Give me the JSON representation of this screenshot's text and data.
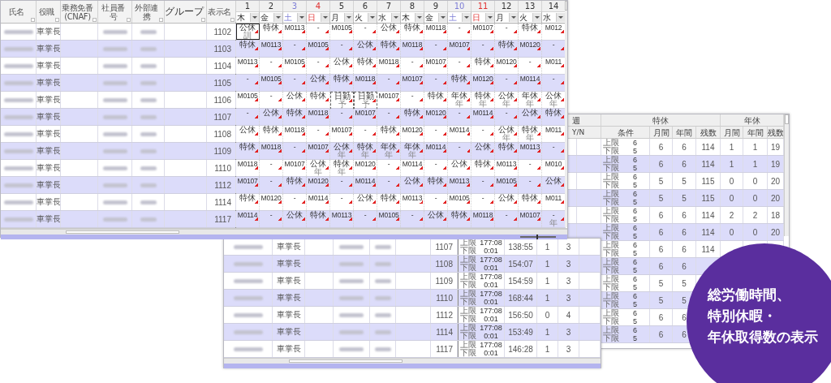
{
  "schedule_window": {
    "zoom": {
      "level": 0.45
    },
    "columns": [
      "氏名",
      "役職",
      "乗務免番 (CNAF)",
      "社員番号",
      "外部連携",
      "グループ",
      "表示名"
    ],
    "days": [
      {
        "number": "1",
        "weekday": "木",
        "kind": "weekday"
      },
      {
        "number": "2",
        "weekday": "金",
        "kind": "weekday"
      },
      {
        "number": "3",
        "weekday": "土",
        "kind": "saturday"
      },
      {
        "number": "4",
        "weekday": "日",
        "kind": "sunday"
      },
      {
        "number": "5",
        "weekday": "月",
        "kind": "weekday"
      },
      {
        "number": "6",
        "weekday": "火",
        "kind": "weekday"
      },
      {
        "number": "7",
        "weekday": "水",
        "kind": "weekday"
      },
      {
        "number": "8",
        "weekday": "木",
        "kind": "weekday"
      },
      {
        "number": "9",
        "weekday": "金",
        "kind": "weekday"
      },
      {
        "number": "10",
        "weekday": "土",
        "kind": "saturday"
      },
      {
        "number": "11",
        "weekday": "日",
        "kind": "sunday"
      },
      {
        "number": "12",
        "weekday": "月",
        "kind": "weekday"
      },
      {
        "number": "13",
        "weekday": "火",
        "kind": "weekday"
      },
      {
        "number": "14",
        "weekday": "水",
        "kind": "weekday"
      }
    ],
    "rows": [
      {
        "role": "車掌長",
        "display_name": "1102",
        "shifts": [
          {
            "text": "公休",
            "sub": "訓",
            "selected": true,
            "tentative": false
          },
          {
            "text": "特休",
            "selected": false,
            "tentative": false
          },
          {
            "text": "M0113",
            "selected": false,
            "tentative": false
          },
          {
            "text": "-",
            "selected": false,
            "tentative": false
          },
          {
            "text": "M0105",
            "selected": false,
            "tentative": false
          },
          {
            "text": "-",
            "selected": false,
            "tentative": false
          },
          {
            "text": "公休",
            "selected": false,
            "tentative": false
          },
          {
            "text": "特休",
            "selected": false,
            "tentative": false
          },
          {
            "text": "M0118",
            "selected": false,
            "tentative": false
          },
          {
            "text": "-",
            "selected": false,
            "tentative": false
          },
          {
            "text": "M0107",
            "selected": false,
            "tentative": false
          },
          {
            "text": "-",
            "selected": false,
            "tentative": false
          },
          {
            "text": "特休",
            "selected": false,
            "tentative": false
          },
          {
            "text": "M012",
            "selected": false,
            "tentative": false
          }
        ]
      },
      {
        "role": "車掌長",
        "display_name": "1103",
        "shifts": [
          {
            "text": "特休",
            "selected": false,
            "tentative": false
          },
          {
            "text": "M0113",
            "selected": false,
            "tentative": false
          },
          {
            "text": "-",
            "selected": false,
            "tentative": false
          },
          {
            "text": "M0105",
            "selected": false,
            "tentative": false
          },
          {
            "text": "-",
            "selected": false,
            "tentative": false
          },
          {
            "text": "公休",
            "selected": false,
            "tentative": false
          },
          {
            "text": "特休",
            "selected": false,
            "tentative": false
          },
          {
            "text": "M0118",
            "selected": false,
            "tentative": false
          },
          {
            "text": "-",
            "selected": false,
            "tentative": false
          },
          {
            "text": "M0107",
            "selected": false,
            "tentative": false
          },
          {
            "text": "-",
            "selected": false,
            "tentative": false
          },
          {
            "text": "特休",
            "selected": false,
            "tentative": false
          },
          {
            "text": "M0120",
            "selected": false,
            "tentative": false
          },
          {
            "text": "-",
            "selected": false,
            "tentative": false
          }
        ]
      },
      {
        "role": "車掌長",
        "display_name": "1104",
        "shifts": [
          {
            "text": "M0113",
            "selected": false,
            "tentative": false
          },
          {
            "text": "-",
            "selected": false,
            "tentative": false
          },
          {
            "text": "M0105",
            "selected": false,
            "tentative": false
          },
          {
            "text": "-",
            "selected": false,
            "tentative": false
          },
          {
            "text": "公休",
            "selected": false,
            "tentative": false
          },
          {
            "text": "特休",
            "selected": false,
            "tentative": false
          },
          {
            "text": "M0118",
            "selected": false,
            "tentative": false
          },
          {
            "text": "-",
            "selected": false,
            "tentative": false
          },
          {
            "text": "M0107",
            "selected": false,
            "tentative": false
          },
          {
            "text": "-",
            "selected": false,
            "tentative": false
          },
          {
            "text": "特休",
            "selected": false,
            "tentative": false
          },
          {
            "text": "M0120",
            "selected": false,
            "tentative": false
          },
          {
            "text": "-",
            "selected": false,
            "tentative": false
          },
          {
            "text": "M011",
            "selected": false,
            "tentative": false
          }
        ]
      },
      {
        "role": "車掌長",
        "display_name": "1105",
        "shifts": [
          {
            "text": "-",
            "selected": false,
            "tentative": false
          },
          {
            "text": "M0105",
            "selected": false,
            "tentative": false
          },
          {
            "text": "-",
            "selected": false,
            "tentative": false
          },
          {
            "text": "公休",
            "selected": false,
            "tentative": false
          },
          {
            "text": "特休",
            "selected": false,
            "tentative": false
          },
          {
            "text": "M0118",
            "selected": false,
            "tentative": false
          },
          {
            "text": "-",
            "selected": false,
            "tentative": false
          },
          {
            "text": "M0107",
            "selected": false,
            "tentative": false
          },
          {
            "text": "-",
            "selected": false,
            "tentative": false
          },
          {
            "text": "特休",
            "selected": false,
            "tentative": false
          },
          {
            "text": "M0120",
            "selected": false,
            "tentative": false
          },
          {
            "text": "-",
            "selected": false,
            "tentative": false
          },
          {
            "text": "M0114",
            "selected": false,
            "tentative": false
          },
          {
            "text": "-",
            "selected": false,
            "tentative": false
          }
        ]
      },
      {
        "role": "車掌長",
        "display_name": "1106",
        "shifts": [
          {
            "text": "M0105",
            "selected": false,
            "tentative": false
          },
          {
            "text": "-",
            "selected": false,
            "tentative": false
          },
          {
            "text": "公休",
            "selected": false,
            "tentative": false
          },
          {
            "text": "特休",
            "selected": false,
            "tentative": false
          },
          {
            "text": "日勤",
            "sub": "予",
            "selected": false,
            "tentative": true
          },
          {
            "text": "日勤",
            "sub": "予",
            "selected": false,
            "tentative": true
          },
          {
            "text": "M0107",
            "selected": false,
            "tentative": false
          },
          {
            "text": "-",
            "selected": false,
            "tentative": false
          },
          {
            "text": "特休",
            "selected": false,
            "tentative": false
          },
          {
            "text": "年休",
            "sub": "年",
            "selected": false,
            "tentative": false
          },
          {
            "text": "特休",
            "sub": "年",
            "selected": false,
            "tentative": false
          },
          {
            "text": "公休",
            "sub": "年",
            "selected": false,
            "tentative": false
          },
          {
            "text": "年休",
            "sub": "年",
            "selected": false,
            "tentative": false
          },
          {
            "text": "公休",
            "sub": "年",
            "selected": false,
            "tentative": false
          }
        ]
      },
      {
        "role": "車掌長",
        "display_name": "1107",
        "shifts": [
          {
            "text": "-",
            "selected": false,
            "tentative": false
          },
          {
            "text": "公休",
            "selected": false,
            "tentative": false
          },
          {
            "text": "特休",
            "selected": false,
            "tentative": false
          },
          {
            "text": "M0118",
            "selected": false,
            "tentative": false
          },
          {
            "text": "-",
            "selected": false,
            "tentative": false
          },
          {
            "text": "M0107",
            "selected": false,
            "tentative": false
          },
          {
            "text": "-",
            "selected": false,
            "tentative": false
          },
          {
            "text": "特休",
            "selected": false,
            "tentative": false
          },
          {
            "text": "M0120",
            "selected": false,
            "tentative": false
          },
          {
            "text": "-",
            "selected": false,
            "tentative": false
          },
          {
            "text": "M0114",
            "selected": false,
            "tentative": false
          },
          {
            "text": "-",
            "selected": false,
            "tentative": false
          },
          {
            "text": "公休",
            "selected": false,
            "tentative": false
          },
          {
            "text": "特休",
            "selected": false,
            "tentative": false
          }
        ]
      },
      {
        "role": "車掌長",
        "display_name": "1108",
        "shifts": [
          {
            "text": "公休",
            "selected": false,
            "tentative": false
          },
          {
            "text": "特休",
            "selected": false,
            "tentative": false
          },
          {
            "text": "M0118",
            "selected": false,
            "tentative": false
          },
          {
            "text": "-",
            "selected": false,
            "tentative": false
          },
          {
            "text": "M0107",
            "selected": false,
            "tentative": false
          },
          {
            "text": "-",
            "selected": false,
            "tentative": false
          },
          {
            "text": "特休",
            "selected": false,
            "tentative": false
          },
          {
            "text": "M0120",
            "selected": false,
            "tentative": false
          },
          {
            "text": "-",
            "selected": false,
            "tentative": false
          },
          {
            "text": "M0114",
            "selected": false,
            "tentative": false
          },
          {
            "text": "-",
            "selected": false,
            "tentative": false
          },
          {
            "text": "公休",
            "sub": "年",
            "selected": false,
            "tentative": false
          },
          {
            "text": "特休",
            "sub": "年",
            "selected": false,
            "tentative": false
          },
          {
            "text": "M011",
            "selected": false,
            "tentative": false
          }
        ]
      },
      {
        "role": "車掌長",
        "display_name": "1109",
        "shifts": [
          {
            "text": "特休",
            "selected": false,
            "tentative": false
          },
          {
            "text": "M0118",
            "selected": false,
            "tentative": false
          },
          {
            "text": "-",
            "selected": false,
            "tentative": false
          },
          {
            "text": "M0107",
            "selected": false,
            "tentative": false
          },
          {
            "text": "公休",
            "sub": "年",
            "selected": false,
            "tentative": false
          },
          {
            "text": "特休",
            "sub": "年",
            "selected": false,
            "tentative": false
          },
          {
            "text": "年休",
            "sub": "年",
            "selected": false,
            "tentative": false
          },
          {
            "text": "年休",
            "sub": "年",
            "selected": false,
            "tentative": false
          },
          {
            "text": "M0114",
            "selected": false,
            "tentative": false
          },
          {
            "text": "-",
            "selected": false,
            "tentative": false
          },
          {
            "text": "公休",
            "selected": false,
            "tentative": false
          },
          {
            "text": "特休",
            "selected": false,
            "tentative": false
          },
          {
            "text": "M0113",
            "selected": false,
            "tentative": false
          },
          {
            "text": "-",
            "selected": false,
            "tentative": false
          }
        ]
      },
      {
        "role": "車掌長",
        "display_name": "1110",
        "shifts": [
          {
            "text": "M0118",
            "selected": false,
            "tentative": false
          },
          {
            "text": "-",
            "selected": false,
            "tentative": false
          },
          {
            "text": "M0107",
            "selected": false,
            "tentative": false
          },
          {
            "text": "公休",
            "sub": "年",
            "selected": false,
            "tentative": false
          },
          {
            "text": "特休",
            "sub": "年",
            "selected": false,
            "tentative": false
          },
          {
            "text": "M0120",
            "selected": false,
            "tentative": false
          },
          {
            "text": "-",
            "selected": false,
            "tentative": false
          },
          {
            "text": "M0114",
            "selected": false,
            "tentative": false
          },
          {
            "text": "-",
            "selected": false,
            "tentative": false
          },
          {
            "text": "公休",
            "selected": false,
            "tentative": false
          },
          {
            "text": "特休",
            "selected": false,
            "tentative": false
          },
          {
            "text": "M0113",
            "selected": false,
            "tentative": false
          },
          {
            "text": "-",
            "selected": false,
            "tentative": false
          },
          {
            "text": "M010",
            "selected": false,
            "tentative": false
          }
        ]
      },
      {
        "role": "車掌長",
        "display_name": "1112",
        "shifts": [
          {
            "text": "M0107",
            "selected": false,
            "tentative": false
          },
          {
            "text": "-",
            "selected": false,
            "tentative": false
          },
          {
            "text": "特休",
            "selected": false,
            "tentative": false
          },
          {
            "text": "M0120",
            "selected": false,
            "tentative": false
          },
          {
            "text": "-",
            "selected": false,
            "tentative": false
          },
          {
            "text": "M0114",
            "selected": false,
            "tentative": false
          },
          {
            "text": "-",
            "selected": false,
            "tentative": false
          },
          {
            "text": "公休",
            "selected": false,
            "tentative": false
          },
          {
            "text": "特休",
            "selected": false,
            "tentative": false
          },
          {
            "text": "M0113",
            "selected": false,
            "tentative": false
          },
          {
            "text": "-",
            "selected": false,
            "tentative": false
          },
          {
            "text": "M0105",
            "selected": false,
            "tentative": false
          },
          {
            "text": "-",
            "selected": false,
            "tentative": false
          },
          {
            "text": "公休",
            "selected": false,
            "tentative": false
          }
        ]
      },
      {
        "role": "車掌長",
        "display_name": "1114",
        "shifts": [
          {
            "text": "特休",
            "selected": false,
            "tentative": false
          },
          {
            "text": "M0120",
            "selected": false,
            "tentative": false
          },
          {
            "text": "-",
            "selected": false,
            "tentative": false
          },
          {
            "text": "M0114",
            "selected": false,
            "tentative": false
          },
          {
            "text": "-",
            "selected": false,
            "tentative": false
          },
          {
            "text": "公休",
            "selected": false,
            "tentative": false
          },
          {
            "text": "特休",
            "selected": false,
            "tentative": false
          },
          {
            "text": "M0113",
            "selected": false,
            "tentative": false
          },
          {
            "text": "-",
            "selected": false,
            "tentative": false
          },
          {
            "text": "M0105",
            "selected": false,
            "tentative": false
          },
          {
            "text": "-",
            "selected": false,
            "tentative": false
          },
          {
            "text": "公休",
            "selected": false,
            "tentative": false
          },
          {
            "text": "特休",
            "selected": false,
            "tentative": false
          },
          {
            "text": "M011",
            "selected": false,
            "tentative": false
          }
        ]
      },
      {
        "role": "車掌長",
        "display_name": "1117",
        "shifts": [
          {
            "text": "M0114",
            "selected": false,
            "tentative": false
          },
          {
            "text": "-",
            "selected": false,
            "tentative": false
          },
          {
            "text": "公休",
            "selected": false,
            "tentative": false
          },
          {
            "text": "特休",
            "selected": false,
            "tentative": false
          },
          {
            "text": "M0113",
            "selected": false,
            "tentative": false
          },
          {
            "text": "-",
            "selected": false,
            "tentative": false
          },
          {
            "text": "M0105",
            "selected": false,
            "tentative": false
          },
          {
            "text": "-",
            "selected": false,
            "tentative": false
          },
          {
            "text": "公休",
            "selected": false,
            "tentative": false
          },
          {
            "text": "特休",
            "selected": false,
            "tentative": false
          },
          {
            "text": "M0118",
            "selected": false,
            "tentative": false
          },
          {
            "text": "-",
            "selected": false,
            "tentative": false
          },
          {
            "text": "M0107",
            "selected": false,
            "tentative": false
          },
          {
            "text": "-",
            "sub": "年",
            "selected": false,
            "tentative": false
          }
        ]
      }
    ]
  },
  "hours_window": {
    "rows": [
      {
        "role": "車掌長",
        "display_name": "1107",
        "upper_label": "上限",
        "upper": "177:08",
        "lower_label": "下限",
        "lower": "0:01",
        "total": "138:55",
        "column_10": "1",
        "column_11": "3"
      },
      {
        "role": "車掌長",
        "display_name": "1108",
        "upper_label": "上限",
        "upper": "177:08",
        "lower_label": "下限",
        "lower": "0:01",
        "total": "154:07",
        "column_10": "1",
        "column_11": "3"
      },
      {
        "role": "車掌長",
        "display_name": "1109",
        "upper_label": "上限",
        "upper": "177:08",
        "lower_label": "下限",
        "lower": "0:01",
        "total": "154:59",
        "column_10": "1",
        "column_11": "3"
      },
      {
        "role": "車掌長",
        "display_name": "1110",
        "upper_label": "上限",
        "upper": "177:08",
        "lower_label": "下限",
        "lower": "0:01",
        "total": "168:44",
        "column_10": "1",
        "column_11": "3"
      },
      {
        "role": "車掌長",
        "display_name": "1112",
        "upper_label": "上限",
        "upper": "177:08",
        "lower_label": "下限",
        "lower": "0:01",
        "total": "156:50",
        "column_10": "0",
        "column_11": "4"
      },
      {
        "role": "車掌長",
        "display_name": "1114",
        "upper_label": "上限",
        "upper": "177:08",
        "lower_label": "下限",
        "lower": "0:01",
        "total": "153:49",
        "column_10": "1",
        "column_11": "3"
      },
      {
        "role": "車掌長",
        "display_name": "1117",
        "upper_label": "上限",
        "upper": "177:08",
        "lower_label": "下限",
        "lower": "0:01",
        "total": "146:28",
        "column_10": "1",
        "column_11": "3"
      }
    ]
  },
  "leave_window": {
    "week_header": "週",
    "flag_header": "Y/N",
    "special_header": "特休",
    "annual_header": "年休",
    "sub_headers": [
      "条件",
      "月間",
      "年間",
      "残数",
      "月間",
      "年間",
      "残数"
    ],
    "rows": [
      {
        "upper_label": "上限",
        "upper": "6",
        "lower_label": "下限",
        "lower": "5",
        "values": [
          "6",
          "6",
          "114",
          "1",
          "1",
          "19"
        ]
      },
      {
        "upper_label": "上限",
        "upper": "6",
        "lower_label": "下限",
        "lower": "5",
        "values": [
          "6",
          "6",
          "114",
          "1",
          "1",
          "19"
        ]
      },
      {
        "upper_label": "上限",
        "upper": "6",
        "lower_label": "下限",
        "lower": "5",
        "values": [
          "5",
          "5",
          "115",
          "0",
          "0",
          "20"
        ]
      },
      {
        "upper_label": "上限",
        "upper": "6",
        "lower_label": "下限",
        "lower": "5",
        "values": [
          "5",
          "5",
          "115",
          "0",
          "0",
          "20"
        ]
      },
      {
        "upper_label": "上限",
        "upper": "6",
        "lower_label": "下限",
        "lower": "5",
        "values": [
          "6",
          "6",
          "114",
          "2",
          "2",
          "18"
        ]
      },
      {
        "upper_label": "上限",
        "upper": "6",
        "lower_label": "下限",
        "lower": "5",
        "values": [
          "6",
          "6",
          "114",
          "0",
          "0",
          "20"
        ]
      },
      {
        "upper_label": "上限",
        "upper": "6",
        "lower_label": "下限",
        "lower": "5",
        "values": [
          "6",
          "6",
          "114"
        ]
      },
      {
        "upper_label": "上限",
        "upper": "6",
        "lower_label": "下限",
        "lower": "5",
        "values": [
          "6",
          "6"
        ]
      },
      {
        "upper_label": "上限",
        "upper": "6",
        "lower_label": "下限",
        "lower": "5",
        "values": [
          "5",
          "5"
        ]
      },
      {
        "upper_label": "上限",
        "upper": "6",
        "lower_label": "下限",
        "lower": "5",
        "values": [
          "5",
          "5"
        ]
      },
      {
        "upper_label": "上限",
        "upper": "6",
        "lower_label": "下限",
        "lower": "5",
        "values": [
          "6",
          "6"
        ]
      },
      {
        "upper_label": "上限",
        "upper": "6",
        "lower_label": "下限",
        "lower": "5",
        "values": [
          "6",
          "6"
        ]
      }
    ]
  },
  "caption": {
    "lines": [
      "総労働時間、",
      "特別休暇・",
      "年休取得数の表示"
    ]
  }
}
